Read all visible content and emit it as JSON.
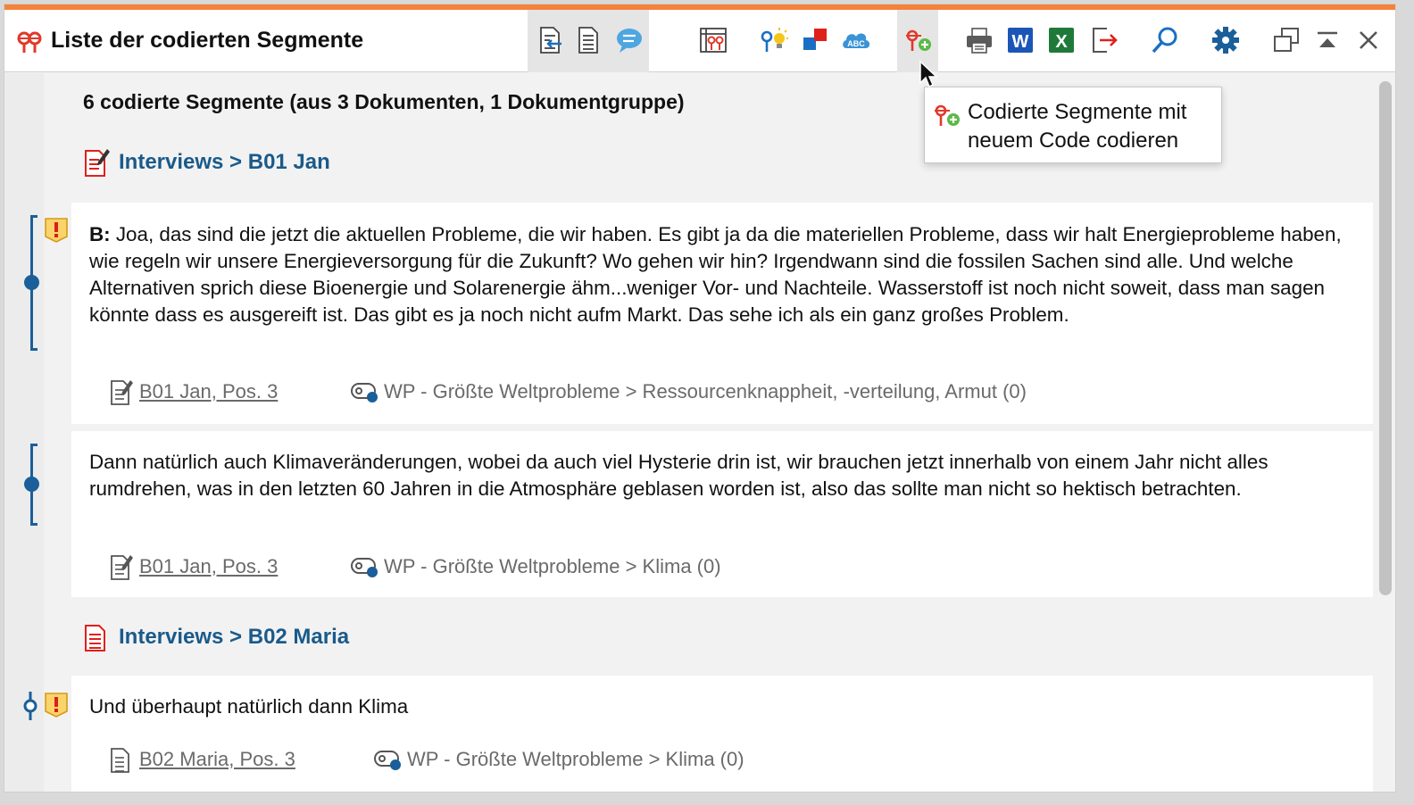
{
  "window": {
    "title": "Liste der codierten Segmente",
    "accent_color": "#f4823a"
  },
  "toolbar": {
    "buttons": [
      {
        "name": "export-segments",
        "icon": "doc-arrow-icon"
      },
      {
        "name": "document-view",
        "icon": "doc-lines-icon"
      },
      {
        "name": "memo-view",
        "icon": "speech-bubble-icon"
      },
      {
        "name": "code-matrix",
        "icon": "matrix-codes-icon"
      },
      {
        "name": "code-ideas",
        "icon": "code-bulb-icon"
      },
      {
        "name": "color-codes",
        "icon": "color-squares-icon"
      },
      {
        "name": "word-cloud",
        "icon": "abc-cloud-icon"
      },
      {
        "name": "code-with-new-code",
        "icon": "code-add-icon"
      },
      {
        "name": "print",
        "icon": "printer-icon"
      },
      {
        "name": "export-word",
        "icon": "word-icon"
      },
      {
        "name": "export-excel",
        "icon": "excel-icon"
      },
      {
        "name": "export",
        "icon": "export-arrow-icon"
      },
      {
        "name": "search",
        "icon": "search-icon"
      },
      {
        "name": "settings",
        "icon": "gear-icon"
      },
      {
        "name": "undock",
        "icon": "undock-window-icon"
      },
      {
        "name": "collapse",
        "icon": "collapse-up-icon"
      },
      {
        "name": "close",
        "icon": "close-icon"
      }
    ]
  },
  "tooltip": {
    "line1": "Codierte Segmente mit",
    "line2": "neuem Code codieren"
  },
  "summary": "6 codierte Segmente (aus 3 Dokumenten, 1 Dokumentgruppe)",
  "documents": [
    {
      "label": "Interviews > B01 Jan",
      "segments": [
        {
          "speaker": "B:",
          "text": " Joa, das sind die jetzt die aktuellen Probleme, die wir haben. Es gibt ja da die materiellen Probleme, dass wir halt Energieprobleme haben, wie regeln wir unsere Energieversorgung für die Zukunft? Wo gehen wir hin? Irgendwann sind die fossilen Sachen sind alle. Und welche Alternativen sprich diese Bioenergie und Solarenergie ähm...weniger Vor- und Nachteile. Wasserstoff ist noch nicht soweit, dass man sagen könnte dass es ausgereift ist. Das gibt es ja noch nicht aufm Markt. Das sehe ich als ein ganz großes Problem.",
          "source": "B01 Jan, Pos. 3",
          "code": "WP - Größte Weltprobleme > Ressourcenknappheit, -verteilung, Armut (0)"
        },
        {
          "speaker": "",
          "text": "Dann natürlich auch Klimaveränderungen, wobei da auch viel Hysterie drin ist, wir brauchen jetzt innerhalb von einem Jahr nicht alles rumdrehen, was in den letzten 60 Jahren in die Atmosphäre geblasen worden ist, also das sollte man nicht so hektisch betrachten.",
          "source": "B01 Jan, Pos. 3",
          "code": "WP - Größte Weltprobleme > Klima (0)"
        }
      ]
    },
    {
      "label": "Interviews > B02 Maria",
      "segments": [
        {
          "speaker": "",
          "text": "Und überhaupt natürlich dann Klima",
          "source": "B02 Maria, Pos. 3",
          "code": "WP - Größte Weltprobleme > Klima (0)"
        }
      ]
    }
  ]
}
